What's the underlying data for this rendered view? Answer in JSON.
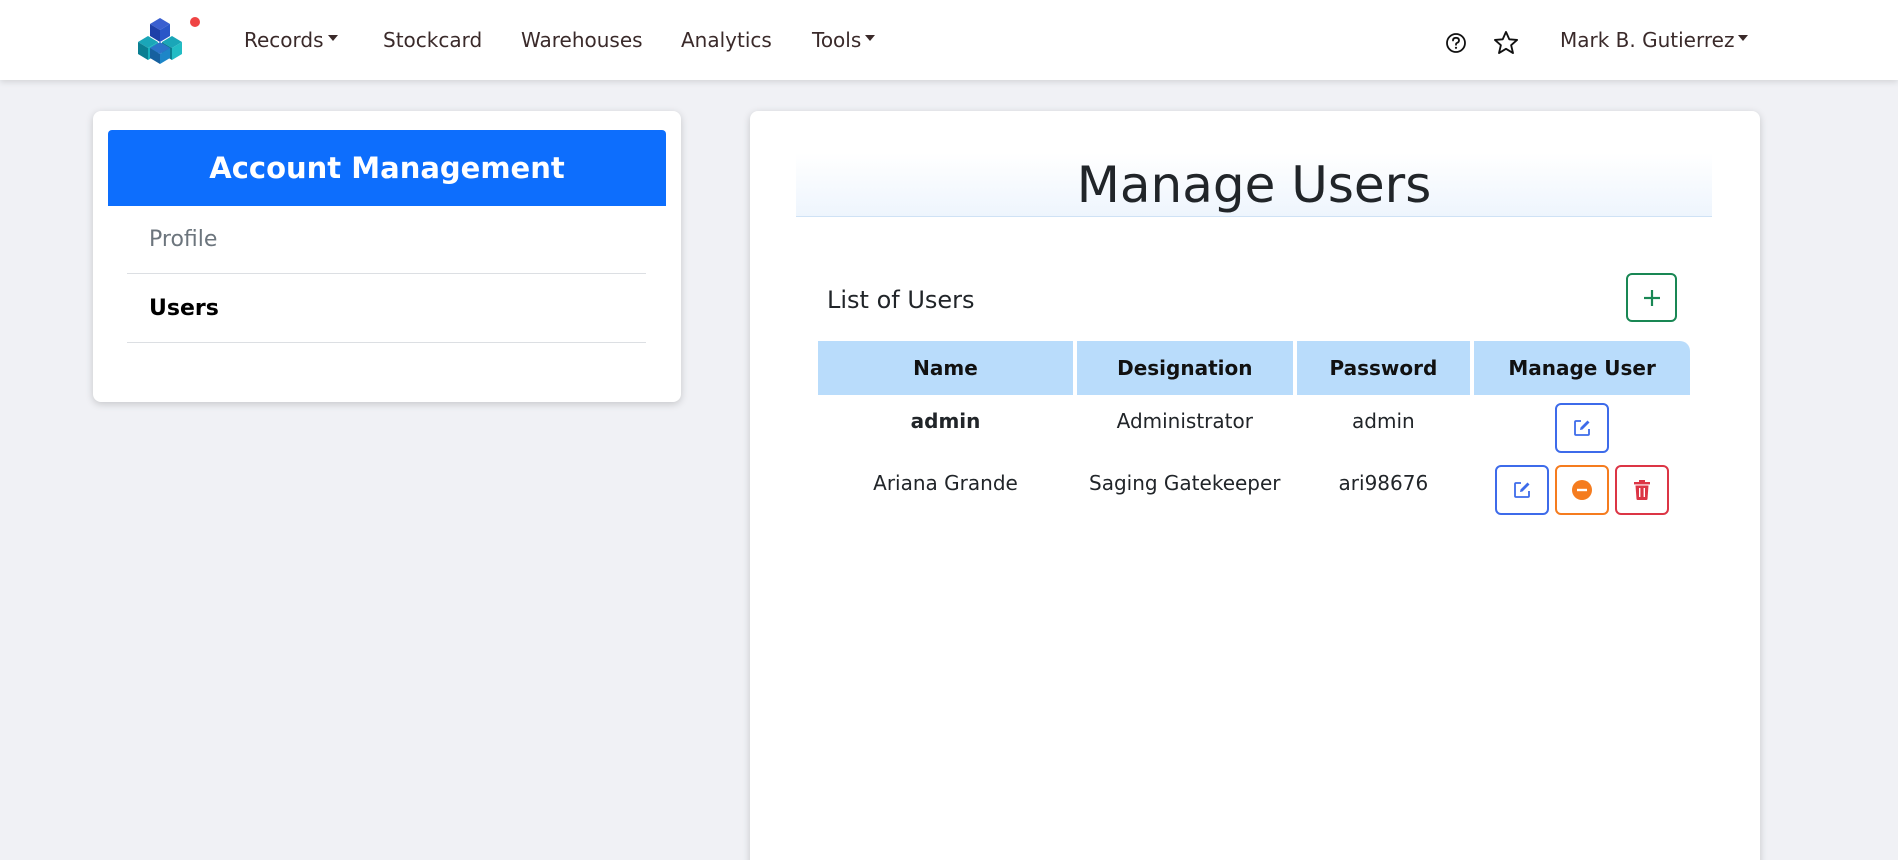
{
  "navbar": {
    "logo_icon": "cubes-logo-icon",
    "notification_dot_color": "#ef4444",
    "items": [
      {
        "label": "Records",
        "dropdown": true
      },
      {
        "label": "Stockcard",
        "dropdown": false
      },
      {
        "label": "Warehouses",
        "dropdown": false
      },
      {
        "label": "Analytics",
        "dropdown": false
      },
      {
        "label": "Tools",
        "dropdown": true
      }
    ],
    "help_icon": "question-circle-icon",
    "star_icon": "star-icon",
    "user_name": "Mark B. Gutierrez"
  },
  "sidebar": {
    "header": "Account Management",
    "header_color": "#0d6efd",
    "items": [
      {
        "label": "Profile",
        "active": false
      },
      {
        "label": "Users",
        "active": true
      }
    ]
  },
  "main": {
    "title": "Manage Users",
    "list_title": "List of Users",
    "add_icon": "plus-icon",
    "table": {
      "columns": [
        "Name",
        "Designation",
        "Password",
        "Manage User"
      ],
      "rows": [
        {
          "name": "admin",
          "designation": "Administrator",
          "password": "admin",
          "actions": [
            "edit"
          ]
        },
        {
          "name": "Ariana Grande",
          "designation": "Saging Gatekeeper",
          "password": "ari98676",
          "actions": [
            "edit",
            "disable",
            "delete"
          ]
        }
      ]
    },
    "colors": {
      "header_bg": "#b9dcfb",
      "edit": "#3d6bea",
      "disable": "#f57c1f",
      "delete": "#dc3545",
      "add": "#198754"
    }
  }
}
